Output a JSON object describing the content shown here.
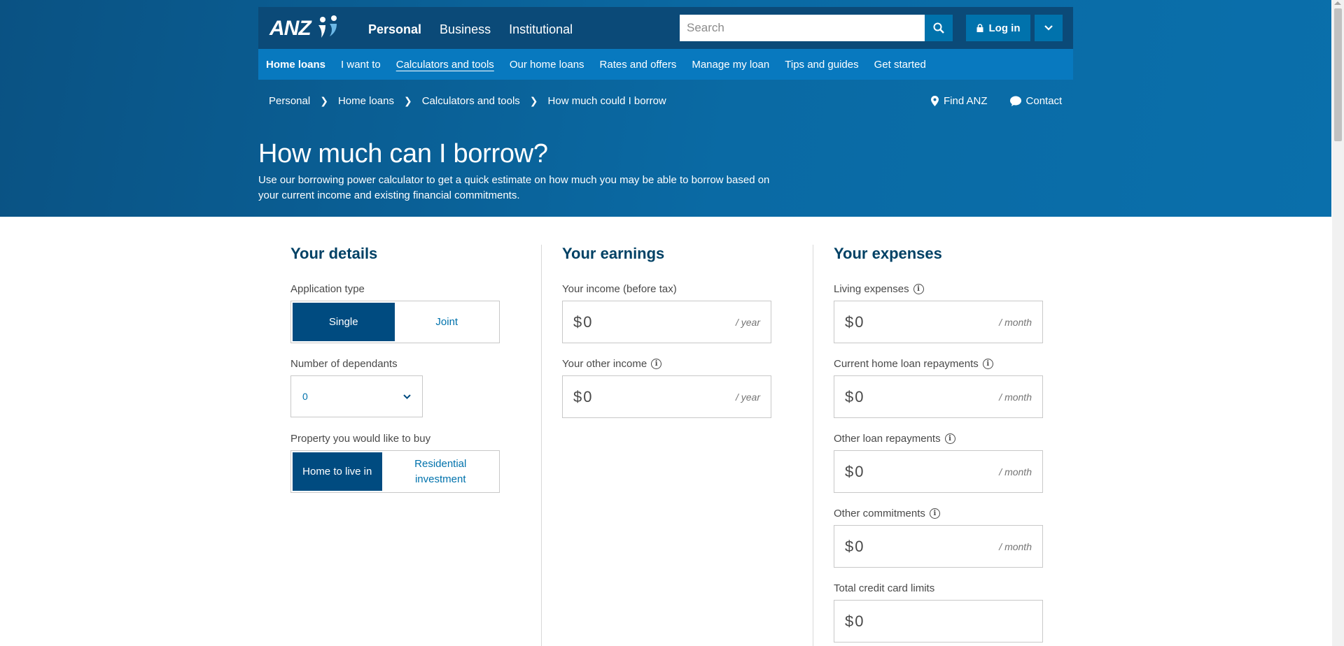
{
  "header": {
    "logo_text": "ANZ",
    "main_nav": [
      "Personal",
      "Business",
      "Institutional"
    ],
    "search_placeholder": "Search",
    "login_label": "Log in"
  },
  "subnav": [
    "Home loans",
    "I want to",
    "Calculators and tools",
    "Our home loans",
    "Rates and offers",
    "Manage my loan",
    "Tips and guides",
    "Get started"
  ],
  "breadcrumb": [
    "Personal",
    "Home loans",
    "Calculators and tools",
    "How much could I borrow"
  ],
  "utils": {
    "find": "Find ANZ",
    "contact": "Contact"
  },
  "hero": {
    "title": "How much can I borrow?",
    "intro": "Use our borrowing power calculator to get a quick estimate on how much you may be able to borrow based on your current income and existing financial commitments."
  },
  "details": {
    "heading": "Your details",
    "app_type_label": "Application type",
    "app_type_options": [
      "Single",
      "Joint"
    ],
    "dependants_label": "Number of dependants",
    "dependants_value": "0",
    "property_label": "Property you would like to buy",
    "property_options": [
      "Home to live in",
      "Residential investment"
    ]
  },
  "earnings": {
    "heading": "Your earnings",
    "income_label": "Your income (before tax)",
    "income_value": "0",
    "income_unit": "/ year",
    "other_income_label": "Your other income",
    "other_income_value": "0",
    "other_income_unit": "/ year"
  },
  "expenses": {
    "heading": "Your expenses",
    "living_label": "Living expenses",
    "living_value": "0",
    "living_unit": "/ month",
    "home_loan_label": "Current home loan repayments",
    "home_loan_value": "0",
    "home_loan_unit": "/ month",
    "other_loan_label": "Other loan repayments",
    "other_loan_value": "0",
    "other_loan_unit": "/ month",
    "commitments_label": "Other commitments",
    "commitments_value": "0",
    "commitments_unit": "/ month",
    "credit_label": "Total credit card limits",
    "credit_value": "0"
  },
  "currency_symbol": "$",
  "info_glyph": "i",
  "colors": {
    "brand_dark": "#004165",
    "brand_blue": "#0072ac",
    "selected": "#004b80"
  }
}
